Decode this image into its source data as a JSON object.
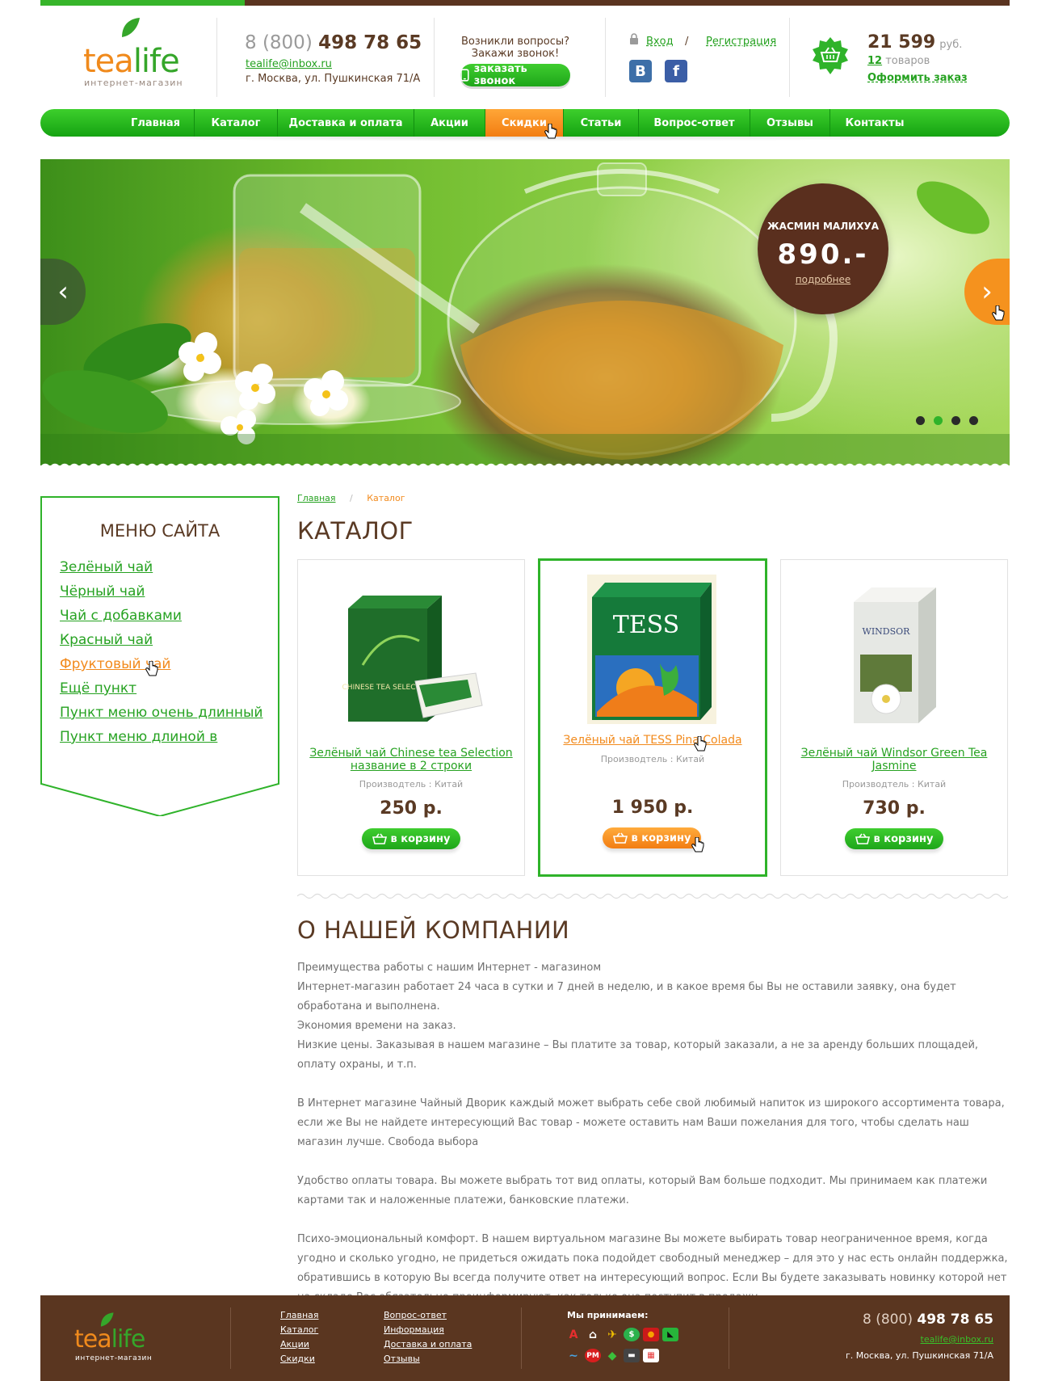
{
  "header": {
    "logo": {
      "tea": "tea",
      "life": "life",
      "subtitle": "интернет-магазин"
    },
    "phone": {
      "prefix": "8 (800)",
      "number": "498 78 65"
    },
    "email": "tealife@inbox.ru",
    "address": "г. Москва, ул. Пушкинская 71/А",
    "question": "Возникли вопросы?",
    "question_sub": "Закажи звонок!",
    "callback_button": "заказать звонок",
    "login": "Вход",
    "slash": "/",
    "register": "Регистрация",
    "social": {
      "vk": "В",
      "fb": "f"
    },
    "cart": {
      "total": "21 599",
      "currency": "руб.",
      "count": "12",
      "count_label": "товаров",
      "checkout": "Оформить заказ"
    }
  },
  "nav": {
    "items": [
      {
        "label": "Главная"
      },
      {
        "label": "Каталог"
      },
      {
        "label": "Доставка и оплата"
      },
      {
        "label": "Акции"
      },
      {
        "label": "Скидки"
      },
      {
        "label": "Статьи"
      },
      {
        "label": "Вопрос-ответ"
      },
      {
        "label": "Отзывы"
      },
      {
        "label": "Контакты"
      }
    ],
    "active_index": 4
  },
  "slider": {
    "promo_name": "ЖАСМИН МАЛИХУА",
    "promo_price": "890.-",
    "promo_link": "подробнее",
    "prev_glyph": "‹",
    "next_glyph": "›",
    "slide_count": 4,
    "active_slide": 1
  },
  "sidebar": {
    "title": "МЕНЮ САЙТА",
    "items": [
      {
        "label": "Зелёный чай"
      },
      {
        "label": "Чёрный чай"
      },
      {
        "label": "Чай с добавками"
      },
      {
        "label": "Красный чай"
      },
      {
        "label": "Фруктовый чай"
      },
      {
        "label": "Ещё пункт"
      },
      {
        "label": "Пункт меню очень длинный"
      },
      {
        "label": "Пункт меню длиной в две строки"
      }
    ],
    "hover_index": 4
  },
  "breadcrumb": {
    "home": "Главная",
    "sep": "/",
    "current": "Каталог"
  },
  "catalog": {
    "title": "КАТАЛОГ",
    "products": [
      {
        "title": "Зелёный чай Chinese tea Selection название в 2 строки",
        "maker": "Производтель : Китай",
        "price": "250 р.",
        "button": "в корзину",
        "box_brand": "CHINESE TEA SELECTION"
      },
      {
        "title": "Зелёный чай TESS Pina Colada",
        "maker": "Производтель : Китай",
        "price": "1 950 р.",
        "button": "в корзину",
        "box_brand": "TESS"
      },
      {
        "title": "Зелёный чай Windsor Green Tea Jasmine",
        "maker": "Производтель : Китай",
        "price": "730 р.",
        "button": "в корзину",
        "box_brand": "WINDSOR"
      }
    ],
    "selected_index": 1
  },
  "about": {
    "title": "О НАШЕЙ КОМПАНИИ",
    "p1": " Преимущества работы с нашим Интернет - магазином",
    "p2": "Интернет-магазин работает 24 часа в сутки и 7 дней в неделю, и в какое время бы Вы не оставили заявку, она будет обработана и выполнена.",
    "p3": "Экономия времени на заказ.",
    "p4": " Низкие цены. Заказывая в нашем магазине – Вы платите за товар, который заказали, а не за аренду больших площадей, оплату охраны, и т.п.",
    "p5": "В Интернет магазине Чайный Дворик каждый может выбрать себе свой любимый напиток из широкого ассортимента товара, если же Вы не найдете интересующий Вас товар - можете оставить нам Ваши пожелания для того, чтобы сделать наш магазин лучше. Свобода выбора",
    "p6": "Удобство оплаты товара. Вы можете выбрать тот вид оплаты, который Вам больше подходит. Мы принимаем как платежи картами так и наложенные платежи, банковские платежи.",
    "p7": "Психо-эмоциональный комфорт. В нашем виртуальном магазине Вы можете выбирать товар неограниченное время, когда угодно и сколько угодно, не придеться ожидать пока подойдет свободный менеджер – для это у нас есть онлайн поддержка, обратившись в которую Вы всегда получите ответ на интересующий вопрос. Если Вы будете заказывать новинку которой нет на складе Вас обязательно проинформируют, как только она поступит в продажу."
  },
  "footer": {
    "col1": [
      "Главная",
      "Каталог",
      "Акции",
      "Скидки"
    ],
    "col2": [
      "Вопрос-ответ",
      "Информация",
      "Доставка и оплата",
      "Отзывы"
    ],
    "accept": "Мы принимаем:",
    "pay_row1": [
      {
        "glyph": "А",
        "color": "#e62e2e",
        "bg": "transparent"
      },
      {
        "glyph": "⌂",
        "color": "#ffffff",
        "bg": "transparent"
      },
      {
        "glyph": "✈",
        "color": "#f5c400",
        "bg": "transparent"
      },
      {
        "glyph": "$",
        "color": "#ffffff",
        "bg": "#2bb24c"
      },
      {
        "glyph": "●",
        "color": "#f7a200",
        "bg": "#cc1a1a"
      },
      {
        "glyph": "◣",
        "color": "#111111",
        "bg": "#27b53a"
      }
    ],
    "pay_row2": [
      {
        "glyph": "∼",
        "color": "#4aa3e0",
        "bg": "transparent"
      },
      {
        "glyph": "PM",
        "color": "#ffffff",
        "bg": "#d81e1e"
      },
      {
        "glyph": "◆",
        "color": "#3bbf3b",
        "bg": "transparent"
      },
      {
        "glyph": "▬",
        "color": "#ffffff",
        "bg": "#444444"
      },
      {
        "glyph": "▦",
        "color": "#e63333",
        "bg": "#ffffff"
      }
    ],
    "phone_prefix": "8 (800)",
    "phone_number": "498 78 65",
    "email": "tealife@inbox.ru",
    "address": "г. Москва, ул. Пушкинская 71/А"
  },
  "colors": {
    "green": "#2fb32a",
    "orange": "#f28a1c",
    "brown": "#5a3620"
  }
}
